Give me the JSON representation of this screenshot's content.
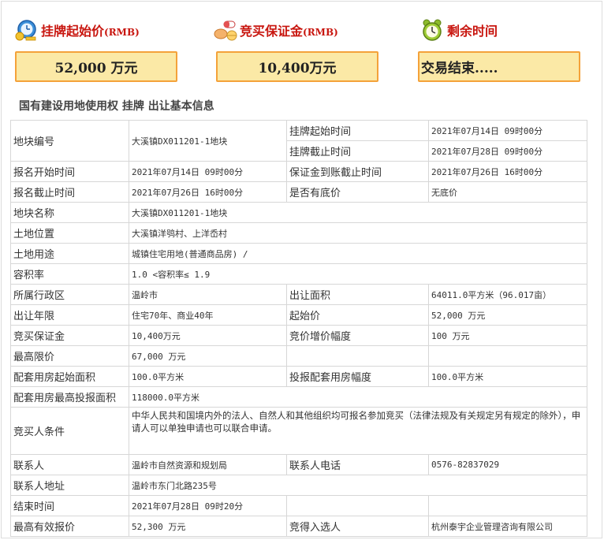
{
  "header": {
    "start_price_label": "挂牌起始价",
    "start_price_unit": "(RMB)",
    "deposit_label": "竞买保证金",
    "deposit_unit": "(RMB)",
    "remaining_label": "剩余时间"
  },
  "summary": {
    "start_price": "52,000 万元",
    "deposit": "10,400万元",
    "remaining": "交易结束....."
  },
  "section_title": "国有建设用地使用权 挂牌 出让基本信息",
  "table": {
    "plot_no_label": "地块编号",
    "plot_no": "大溪镇DX011201-1地块",
    "listing_start_label": "挂牌起始时间",
    "listing_start": "2021年07月14日 09时00分",
    "listing_end_label": "挂牌截止时间",
    "listing_end": "2021年07月28日 09时00分",
    "signup_start_label": "报名开始时间",
    "signup_start": "2021年07月14日 09时00分",
    "deposit_deadline_label": "保证金到账截止时间",
    "deposit_deadline": "2021年07月26日 16时00分",
    "signup_end_label": "报名截止时间",
    "signup_end": "2021年07月26日 16时00分",
    "reserve_label": "是否有底价",
    "reserve": "无底价",
    "plot_name_label": "地块名称",
    "plot_name": "大溪镇DX011201-1地块",
    "location_label": "土地位置",
    "location": "大溪镇洋鸮村、上洋岙村",
    "usage_label": "土地用途",
    "usage": "城镇住宅用地(普通商品房) /",
    "far_label": "容积率",
    "far": "1.0 <容积率≤ 1.9",
    "district_label": "所属行政区",
    "district": "温岭市",
    "area_label": "出让面积",
    "area": "64011.0平方米（96.017亩）",
    "term_label": "出让年限",
    "term": "住宅70年、商业40年",
    "start_price_label": "起始价",
    "start_price": "52,000 万元",
    "deposit_label": "竞买保证金",
    "deposit": "10,400万元",
    "increment_label": "竞价增价幅度",
    "increment": "100 万元",
    "max_price_label": "最高限价",
    "max_price": "67,000 万元",
    "housing_start_label": "配套用房起始面积",
    "housing_start": "100.0平方米",
    "housing_increment_label": "投报配套用房幅度",
    "housing_increment": "100.0平方米",
    "housing_max_label": "配套用房最高投报面积",
    "housing_max": "118000.0平方米",
    "bidder_label": "竞买人条件",
    "bidder": "中华人民共和国境内外的法人、自然人和其他组织均可报名参加竞买（法律法规及有关规定另有规定的除外），申请人可以单独申请也可以联合申请。",
    "contact_label": "联系人",
    "contact": "温岭市自然资源和规划局",
    "phone_label": "联系人电话",
    "phone": "0576-82837029",
    "address_label": "联系人地址",
    "address": "温岭市东门北路235号",
    "end_time_label": "结束时间",
    "end_time": "2021年07月28日 09时20分",
    "highest_bid_label": "最高有效报价",
    "highest_bid": "52,300 万元",
    "winner_label": "竞得入选人",
    "winner": "杭州泰宇企业管理咨询有限公司"
  },
  "icons": {
    "start_price": "money-clock-icon",
    "deposit": "pills-icon",
    "remaining": "alarm-clock-icon"
  },
  "colors": {
    "accent": "#c8150e",
    "box_fill": "#fbe9a6",
    "box_border": "#f4a23a"
  }
}
